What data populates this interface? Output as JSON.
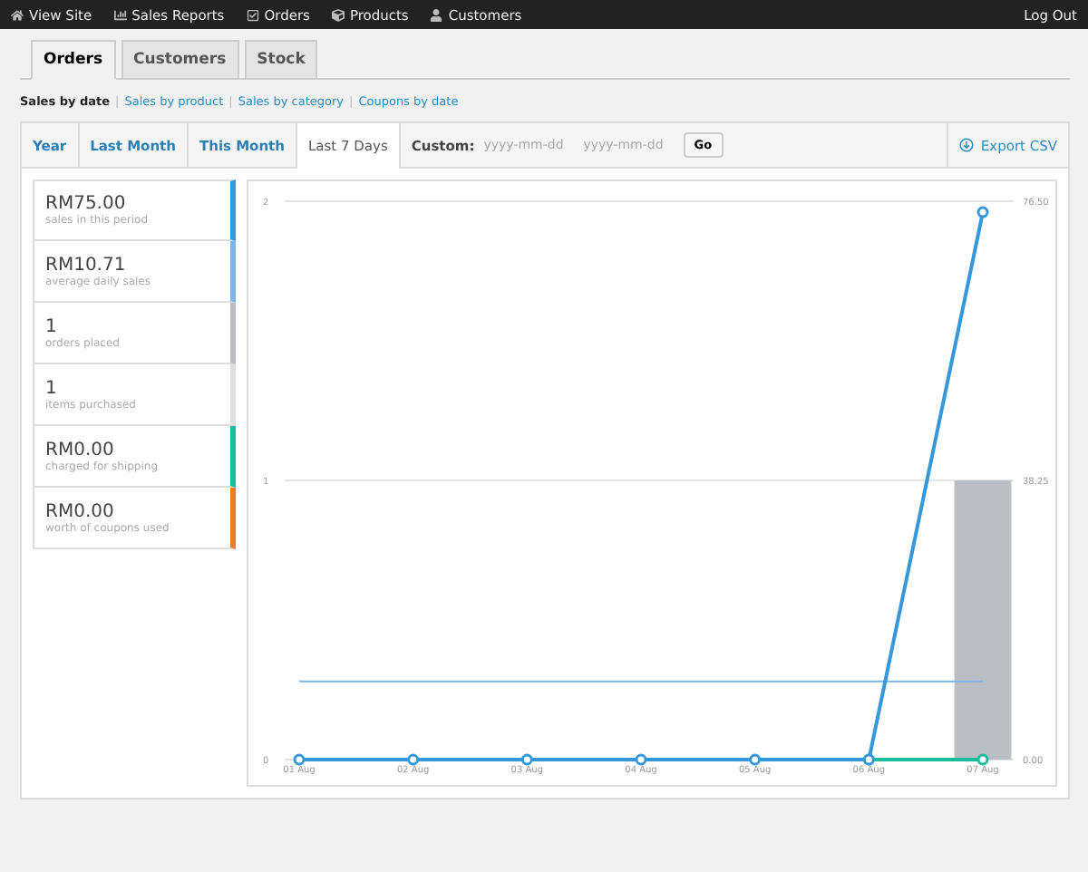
{
  "admin_bar": {
    "items": [
      {
        "label": "View Site"
      },
      {
        "label": "Sales Reports"
      },
      {
        "label": "Orders"
      },
      {
        "label": "Products"
      },
      {
        "label": "Customers"
      }
    ],
    "logout": "Log Out"
  },
  "report_tabs": [
    {
      "label": "Orders",
      "selected": true
    },
    {
      "label": "Customers",
      "selected": false
    },
    {
      "label": "Stock",
      "selected": false
    }
  ],
  "sub_links": [
    {
      "label": "Sales by date",
      "selected": true
    },
    {
      "separator": "|",
      "label": "Sales by product",
      "selected": false
    },
    {
      "separator": "|",
      "label": "Sales by category",
      "selected": false
    },
    {
      "separator": "|",
      "label": "Coupons by date",
      "selected": false
    }
  ],
  "range_tabs": [
    {
      "label": "Year",
      "selected": false
    },
    {
      "label": "Last Month",
      "selected": false
    },
    {
      "label": "This Month",
      "selected": false
    },
    {
      "label": "Last 7 Days",
      "selected": true
    }
  ],
  "custom": {
    "label": "Custom:",
    "start": {
      "placeholder": "yyyy-mm-dd"
    },
    "end": {
      "placeholder": "yyyy-mm-dd"
    },
    "button": "Go"
  },
  "export": "Export CSV",
  "legend": [
    {
      "value": "RM75.00",
      "label": "sales in this period",
      "color": "#3498db"
    },
    {
      "value": "RM10.71",
      "label": "average daily sales",
      "color": "#7cb5ec"
    },
    {
      "value": "1",
      "label": "orders placed",
      "color": "#b8bec4"
    },
    {
      "value": "1",
      "label": "items purchased",
      "color": "#dde0e3"
    },
    {
      "value": "RM0.00",
      "label": "charged for shipping",
      "color": "#1abc9c"
    },
    {
      "value": "RM0.00",
      "label": "worth of coupons used",
      "color": "#e67e22"
    }
  ],
  "chart": {
    "chart_data": {
      "type": "line",
      "categories": [
        "01 Aug",
        "02 Aug",
        "03 Aug",
        "04 Aug",
        "05 Aug",
        "06 Aug",
        "07 Aug"
      ],
      "series": [
        {
          "type": "bar",
          "axis": "y2",
          "color": "#b8bec4",
          "values": [
            0,
            0,
            0,
            0,
            0,
            0,
            1
          ]
        },
        {
          "color": "#7cb5ec",
          "values": [
            10.71,
            10.71,
            10.71,
            10.71,
            10.71,
            10.71,
            10.71
          ]
        },
        {
          "color": "#1abc9c",
          "marker": "o",
          "values": [
            null,
            null,
            null,
            null,
            null,
            0,
            0
          ]
        },
        {
          "color": "#3498db",
          "marker": "o",
          "values": [
            0,
            0,
            0,
            0,
            0,
            0,
            75
          ]
        }
      ],
      "ylim": [
        0,
        76.5
      ],
      "yticks": [
        {
          "value": 0,
          "label": "0.00"
        },
        {
          "value": 38.25,
          "label": "38.25"
        },
        {
          "value": 76.5,
          "label": "76.50"
        }
      ],
      "y2lim": [
        0,
        2
      ],
      "y2ticks": [
        0,
        1,
        2
      ]
    }
  }
}
